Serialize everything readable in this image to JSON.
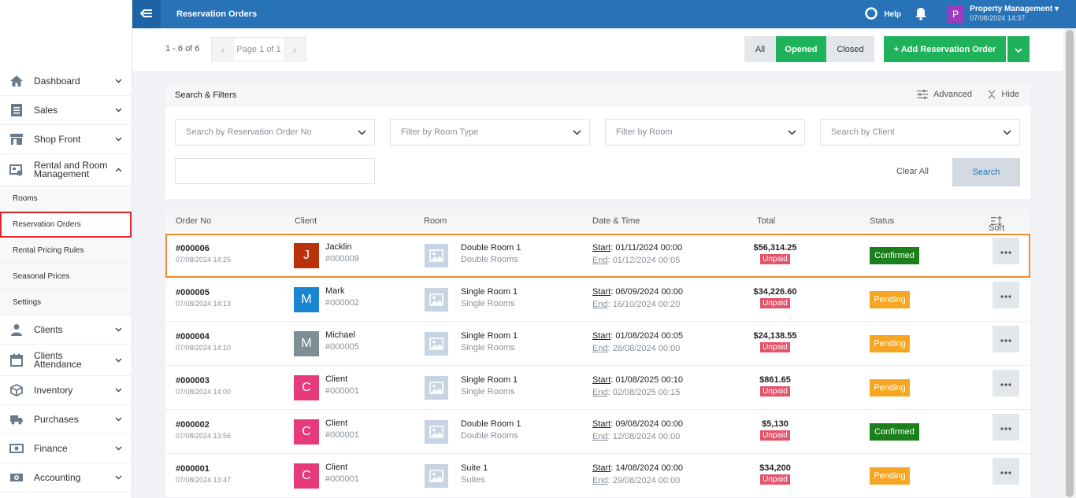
{
  "topbar": {
    "title": "Reservation Orders",
    "help": "Help",
    "user_avatar": "P",
    "user_name": "Property Management",
    "user_date": "07/08/2024 14:37"
  },
  "sidebar": {
    "items": [
      {
        "label": "Dashboard",
        "icon": "home-icon"
      },
      {
        "label": "Sales",
        "icon": "receipt-icon"
      },
      {
        "label": "Shop Front",
        "icon": "store-icon"
      },
      {
        "label": "Rental and Room Management",
        "icon": "rental-icon"
      }
    ],
    "sub_items": [
      {
        "label": "Rooms"
      },
      {
        "label": "Reservation Orders"
      },
      {
        "label": "Rental Pricing Rules"
      },
      {
        "label": "Seasonal Prices"
      },
      {
        "label": "Settings"
      }
    ],
    "items_after": [
      {
        "label": "Clients",
        "icon": "clients-icon"
      },
      {
        "label": "Clients Attendance",
        "icon": "calendar-icon"
      },
      {
        "label": "Inventory",
        "icon": "box-icon"
      },
      {
        "label": "Purchases",
        "icon": "truck-icon"
      },
      {
        "label": "Finance",
        "icon": "money-icon"
      },
      {
        "label": "Accounting",
        "icon": "accounting-icon"
      }
    ]
  },
  "toolbar": {
    "count": "1 - 6 of 6",
    "page": "Page 1 of 1",
    "filter_all": "All",
    "filter_opened": "Opened",
    "filter_closed": "Closed",
    "add_label": "+ Add Reservation Order"
  },
  "filters": {
    "title": "Search & Filters",
    "advanced": "Advanced",
    "hide": "Hide",
    "order_no_placeholder": "Search by Reservation Order No",
    "room_type_placeholder": "Filter by Room Type",
    "room_placeholder": "Filter by Room",
    "client_placeholder": "Search by Client",
    "clear_all": "Clear All",
    "search": "Search"
  },
  "table": {
    "headers": {
      "order_no": "Order No",
      "client": "Client",
      "room": "Room",
      "date_time": "Date & Time",
      "total": "Total",
      "status": "Status",
      "sort": "Sort"
    },
    "start_label": "Start",
    "end_label": "End",
    "unpaid_label": "Unpaid",
    "rows": [
      {
        "order_no": "#000006",
        "order_date": "07/08/2024 14:25",
        "client_initial": "J",
        "avatar_color": "#b8330c",
        "client_name": "Jacklin",
        "client_id": "#000009",
        "room_name": "Double Room 1",
        "room_type": "Double Rooms",
        "start": ": 01/11/2024 00:00",
        "end": ": 01/12/2024 00:05",
        "total": "$56,314.25",
        "status": "Confirmed"
      },
      {
        "order_no": "#000005",
        "order_date": "07/08/2024 14:13",
        "client_initial": "M",
        "avatar_color": "#1a85d0",
        "client_name": "Mark",
        "client_id": "#000002",
        "room_name": "Single Room 1",
        "room_type": "Single Rooms",
        "start": ": 06/09/2024 00:00",
        "end": ": 16/10/2024 00:20",
        "total": "$34,226.60",
        "status": "Pending"
      },
      {
        "order_no": "#000004",
        "order_date": "07/08/2024 14:10",
        "client_initial": "M",
        "avatar_color": "#7b8f95",
        "client_name": "Michael",
        "client_id": "#000005",
        "room_name": "Single Room 1",
        "room_type": "Single Rooms",
        "start": ": 01/08/2024 00:05",
        "end": ": 28/08/2024 00:00",
        "total": "$24,138.55",
        "status": "Pending"
      },
      {
        "order_no": "#000003",
        "order_date": "07/08/2024 14:00",
        "client_initial": "C",
        "avatar_color": "#e63a7a",
        "client_name": "Client",
        "client_id": "#000001",
        "room_name": "Single Room 1",
        "room_type": "Single Rooms",
        "start": ": 01/08/2025 00:10",
        "end": ": 02/08/2025 00:15",
        "total": "$861.65",
        "status": "Pending"
      },
      {
        "order_no": "#000002",
        "order_date": "07/08/2024 13:56",
        "client_initial": "C",
        "avatar_color": "#e63a7a",
        "client_name": "Client",
        "client_id": "#000001",
        "room_name": "Double Room 1",
        "room_type": "Double Rooms",
        "start": ": 09/08/2024 00:00",
        "end": ": 12/08/2024 00:00",
        "total": "$5,130",
        "status": "Confirmed"
      },
      {
        "order_no": "#000001",
        "order_date": "07/08/2024 13:47",
        "client_initial": "C",
        "avatar_color": "#e63a7a",
        "client_name": "Client",
        "client_id": "#000001",
        "room_name": "Suite 1",
        "room_type": "Suites",
        "start": ": 14/08/2024 00:00",
        "end": ": 29/08/2024 00:00",
        "total": "$34,200",
        "status": "Pending"
      }
    ]
  },
  "colors": {
    "topbar": "#2873b8",
    "green": "#1fb25a",
    "confirmed": "#1b7f1b",
    "pending": "#f5a623",
    "unpaid": "#e5536a",
    "selected_row_border": "#ef8b34",
    "active_menu_border": "#e0262b"
  }
}
